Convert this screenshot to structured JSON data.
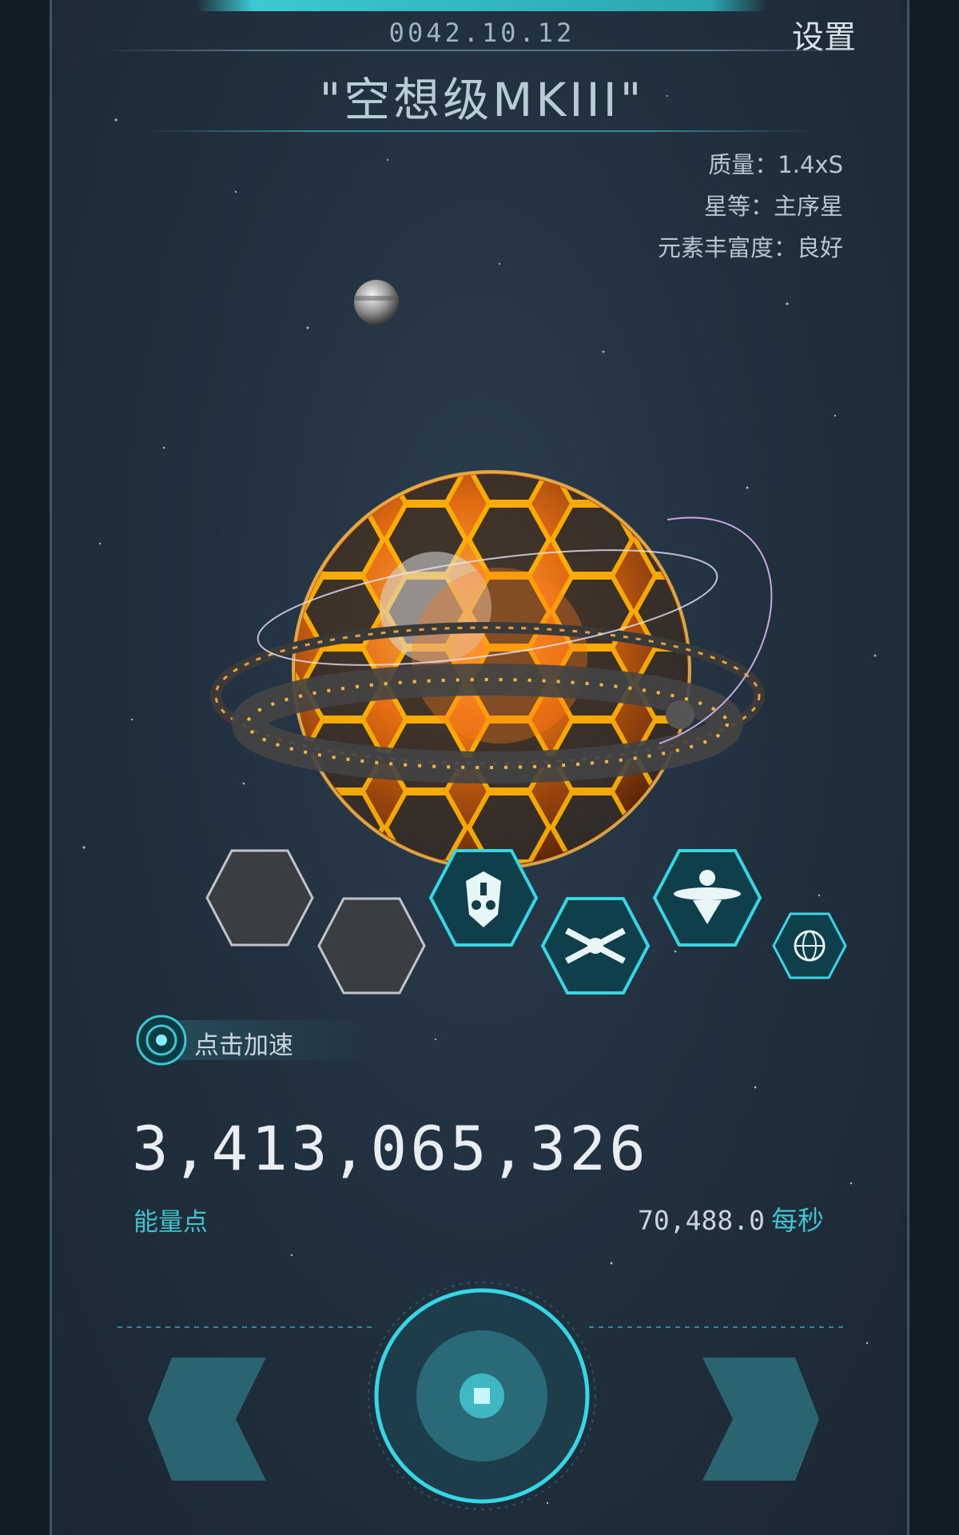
{
  "header": {
    "date": "0042.10.12",
    "settings_label": "设置",
    "star_name": "\"空想级MKIII\""
  },
  "star_info": {
    "mass": "质量：1.4xS",
    "class": "星等：主序星",
    "richness": "元素丰富度：良好"
  },
  "boost": {
    "label": "点击加速"
  },
  "energy": {
    "value": "3,413,065,326",
    "label": "能量点",
    "rate_value": "70,488.0",
    "rate_unit": "每秒"
  },
  "modules": [
    {
      "name": "empty-slot-1",
      "state": "empty"
    },
    {
      "name": "empty-slot-2",
      "state": "empty"
    },
    {
      "name": "mask-module-icon",
      "state": "active"
    },
    {
      "name": "crossed-blades-module-icon",
      "state": "active"
    },
    {
      "name": "orbital-eye-module-icon",
      "state": "active"
    },
    {
      "name": "globe-module-icon",
      "state": "active"
    }
  ],
  "colors": {
    "accent": "#3cc8d2",
    "background": "#22313f",
    "lava": "#f08a1e"
  }
}
